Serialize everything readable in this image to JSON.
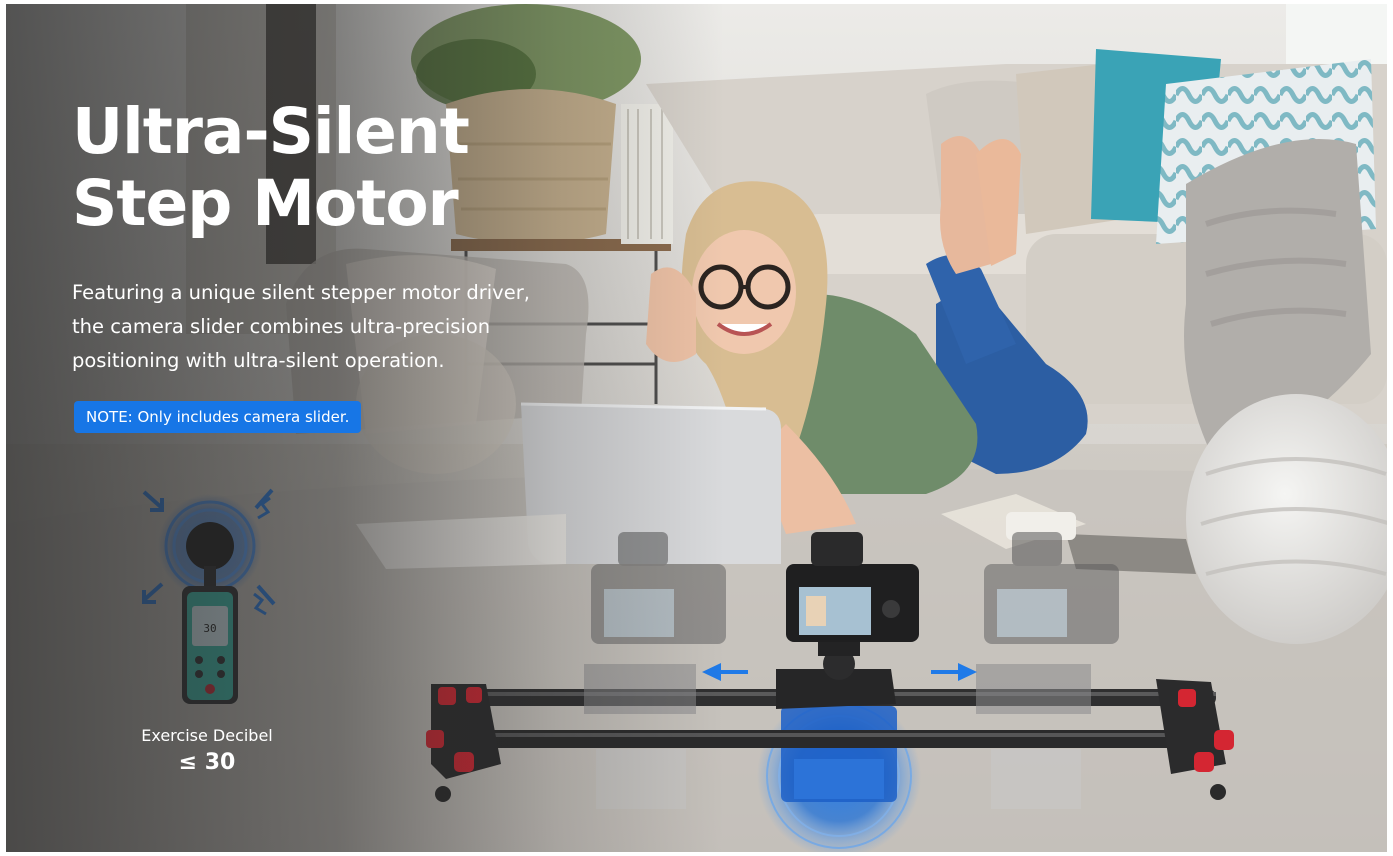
{
  "banner": {
    "headline_line1": "Ultra-Silent",
    "headline_line2": "Step Motor",
    "description_lines": [
      "Featuring a unique silent stepper motor driver,",
      "the camera slider combines ultra-precision",
      "positioning with ultra-silent operation."
    ],
    "note": "NOTE: Only includes camera slider."
  },
  "meter": {
    "label": "Exercise Decibel",
    "value": "≤ 30",
    "icon": "sound-level-meter-icon"
  },
  "colors": {
    "accent_blue": "#1776e6",
    "slider_red": "#d42632",
    "text_white": "#ffffff"
  }
}
